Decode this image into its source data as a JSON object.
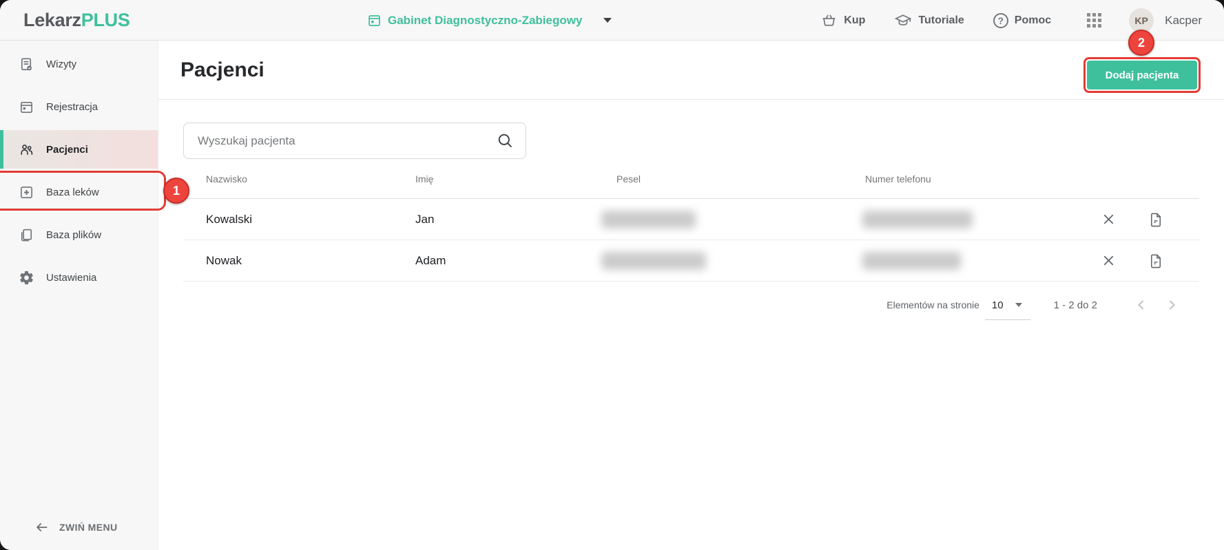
{
  "header": {
    "logo_part1": "Lekarz",
    "logo_part2": "PLUS",
    "clinic_selector": "Gabinet Diagnostyczno-Zabiegowy",
    "kup_label": "Kup",
    "tutoriale_label": "Tutoriale",
    "pomoc_label": "Pomoc",
    "help_glyph": "?",
    "user_initials": "KP",
    "user_name": "Kacper"
  },
  "sidebar": {
    "items": [
      {
        "label": "Wizyty"
      },
      {
        "label": "Rejestracja"
      },
      {
        "label": "Pacjenci",
        "active": true
      },
      {
        "label": "Baza leków"
      },
      {
        "label": "Baza plików"
      },
      {
        "label": "Ustawienia"
      }
    ],
    "collapse_label": "ZWIŃ MENU"
  },
  "main": {
    "title": "Pacjenci",
    "add_button_label": "Dodaj pacjenta",
    "search_placeholder": "Wyszukaj pacjenta",
    "table": {
      "columns": [
        "Nazwisko",
        "Imię",
        "Pesel",
        "Numer telefonu"
      ],
      "rows": [
        {
          "nazwisko": "Kowalski",
          "imie": "Jan",
          "pesel_redacted": true,
          "telefon_redacted": true
        },
        {
          "nazwisko": "Nowak",
          "imie": "Adam",
          "pesel_redacted": true,
          "telefon_redacted": true
        }
      ]
    },
    "pagination": {
      "per_page_label": "Elementów na stronie",
      "per_page_value": "10",
      "range_text": "1 - 2 do 2"
    }
  },
  "annotations": {
    "step1": "1",
    "step2": "2"
  },
  "colors": {
    "brand_green": "#3fc09c",
    "annotation_red": "#e23c33",
    "topbar_bg": "#f7f7f7"
  }
}
